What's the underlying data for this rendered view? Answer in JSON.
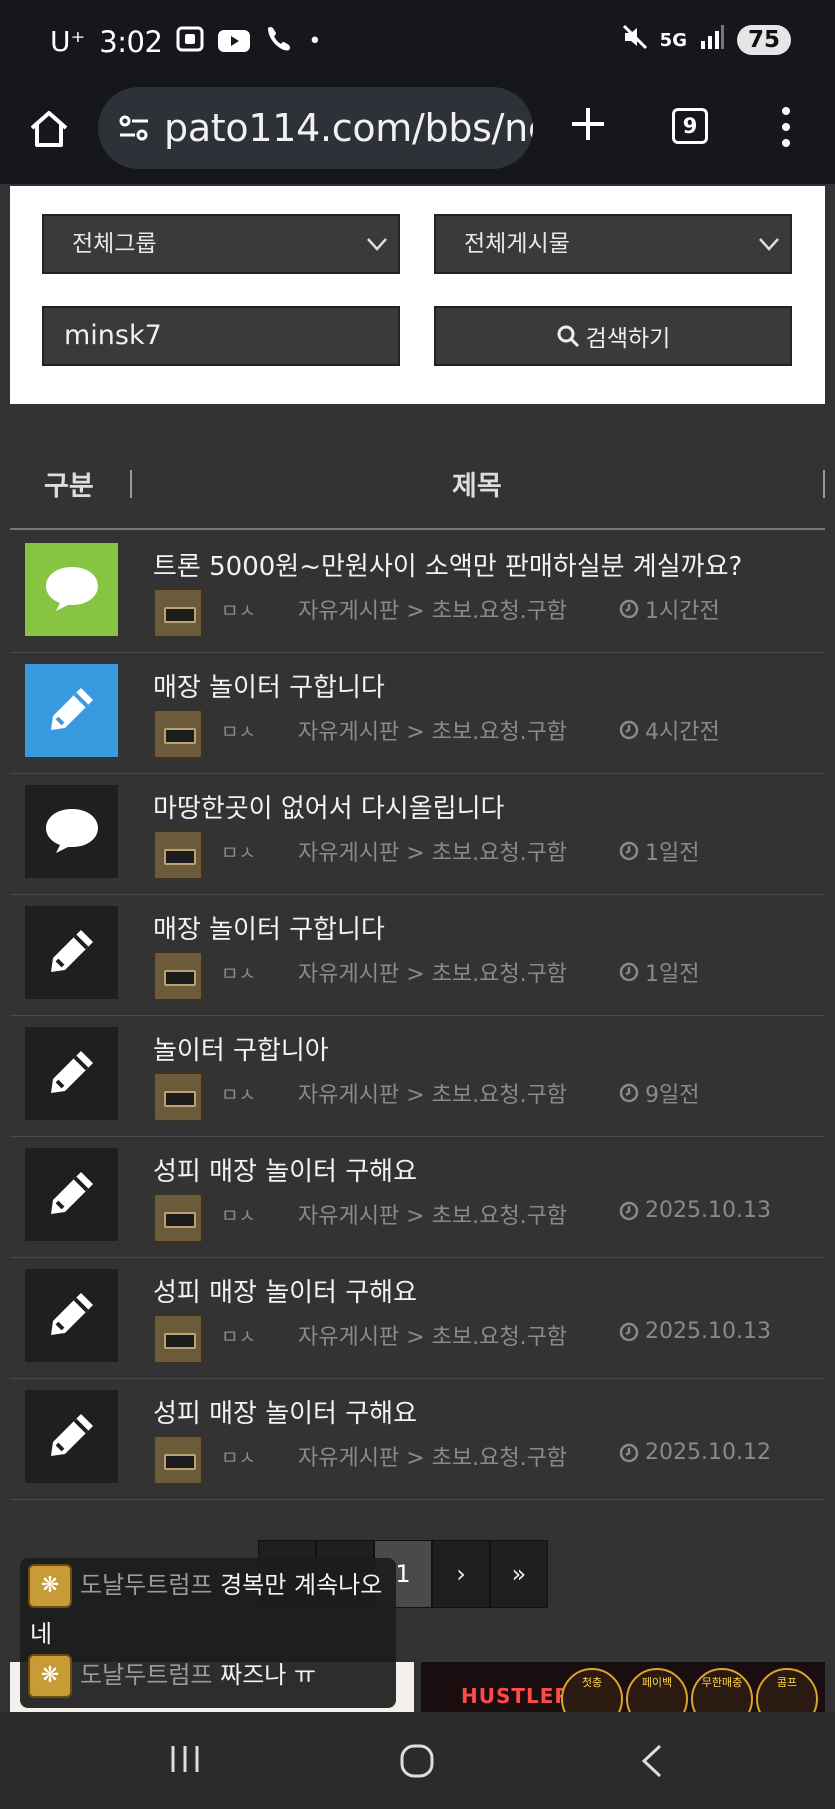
{
  "status_bar": {
    "carrier": "U⁺",
    "time": "3:02",
    "battery": "75",
    "network": "5G"
  },
  "browser": {
    "url": "pato114.com/bbs/ne",
    "tab_count": "9"
  },
  "search": {
    "group_select": "전체그룹",
    "board_select": "전체게시물",
    "query": "minsk7",
    "button_label": "검색하기"
  },
  "table": {
    "col_category": "구분",
    "col_title": "제목"
  },
  "posts": [
    {
      "title": "트론 5000원~만원사이 소액만 판매하실분 계실까요?",
      "author": "ㅁㅅ",
      "board": "자유게시판 > 초보.요청.구함",
      "time": "1시간전",
      "icon": "speech-bubble-icon",
      "color": "#86c441"
    },
    {
      "title": "매장 놀이터 구합니다",
      "author": "ㅁㅅ",
      "board": "자유게시판 > 초보.요청.구함",
      "time": "4시간전",
      "icon": "pencil-icon",
      "color": "#3a9ae0"
    },
    {
      "title": "마땅한곳이 없어서 다시올립니다",
      "author": "ㅁㅅ",
      "board": "자유게시판 > 초보.요청.구함",
      "time": "1일전",
      "icon": "speech-bubble-icon",
      "color": "#1f1f1f"
    },
    {
      "title": "매장 놀이터 구합니다",
      "author": "ㅁㅅ",
      "board": "자유게시판 > 초보.요청.구함",
      "time": "1일전",
      "icon": "pencil-icon",
      "color": "#1f1f1f"
    },
    {
      "title": "놀이터 구합니아",
      "author": "ㅁㅅ",
      "board": "자유게시판 > 초보.요청.구함",
      "time": "9일전",
      "icon": "pencil-icon",
      "color": "#1f1f1f"
    },
    {
      "title": "성피 매장 놀이터 구해요",
      "author": "ㅁㅅ",
      "board": "자유게시판 > 초보.요청.구함",
      "time": "2025.10.13",
      "icon": "pencil-icon",
      "color": "#1f1f1f"
    },
    {
      "title": "성피 매장 놀이터 구해요",
      "author": "ㅁㅅ",
      "board": "자유게시판 > 초보.요청.구함",
      "time": "2025.10.13",
      "icon": "pencil-icon",
      "color": "#1f1f1f"
    },
    {
      "title": "성피 매장 놀이터 구해요",
      "author": "ㅁㅅ",
      "board": "자유게시판 > 초보.요청.구함",
      "time": "2025.10.12",
      "icon": "pencil-icon",
      "color": "#1f1f1f"
    }
  ],
  "pagination": {
    "current": "1",
    "next": "›",
    "last": "»"
  },
  "chat": [
    {
      "name": "도날두트럼프",
      "message": "경복만 계속나오",
      "message_cont": "네"
    },
    {
      "name": "도날두트럼프",
      "message": "짜즈나 ㅠ"
    }
  ],
  "banners": {
    "right_logo": "HUSTLER",
    "right_badges": [
      "첫충",
      "페이백",
      "무한매충",
      "콤프"
    ]
  }
}
